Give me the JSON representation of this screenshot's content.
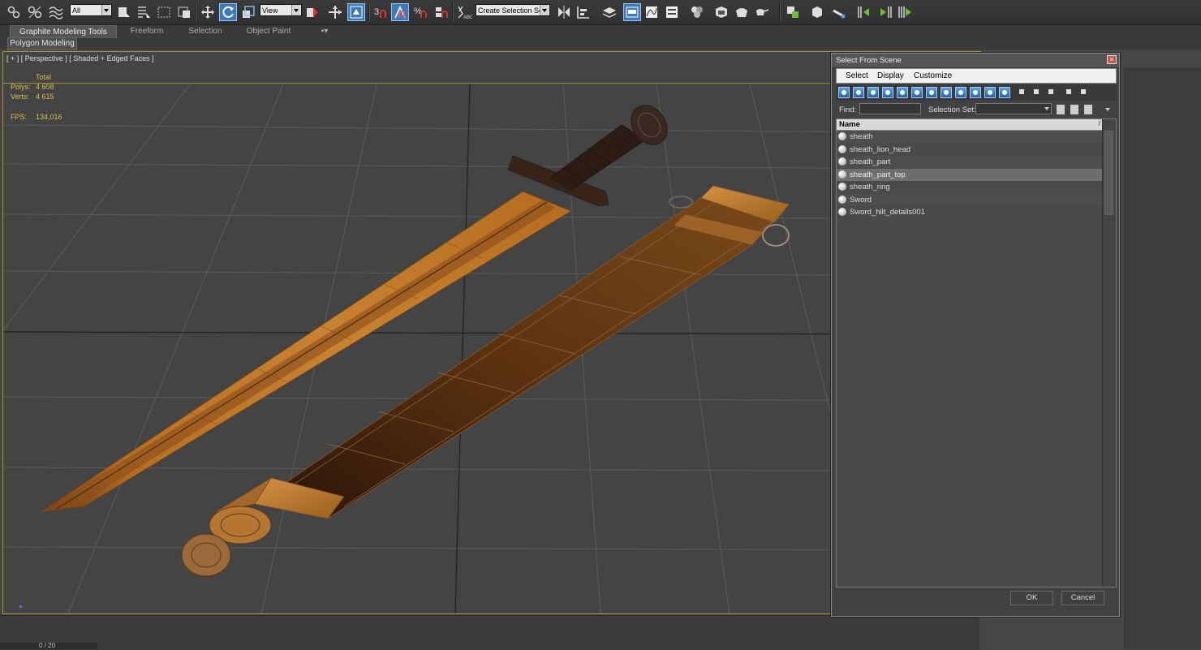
{
  "toolbar": {
    "selection_filter": "All",
    "reference_coordinate": "View",
    "named_selection_set": "Create Selection Se",
    "snaps_label": "3",
    "percent_snap_label": "%"
  },
  "ribbon": {
    "tabs": [
      "Graphite Modeling Tools",
      "Freeform",
      "Selection",
      "Object Paint"
    ],
    "panel": "Polygon Modeling"
  },
  "viewport": {
    "label": "[ + ] [ Perspective ] [ Shaded + Edged Faces ]",
    "stats": {
      "header": "Total",
      "polys_label": "Polys:",
      "polys_value": "4 608",
      "verts_label": "Verts:",
      "verts_value": "4 615",
      "fps_label": "FPS:",
      "fps_value": "134,016"
    }
  },
  "timeslider": {
    "label": "0 / 20"
  },
  "dialog": {
    "title": "Select From Scene",
    "close": "×",
    "menu": [
      "Select",
      "Display",
      "Customize"
    ],
    "find_label": "Find:",
    "find_value": "",
    "selection_set_label": "Selection Set:",
    "list_header": "Name",
    "sort_indicator": "/",
    "objects": [
      "sheath",
      "sheath_lion_head",
      "sheath_part",
      "sheath_part_top",
      "sheath_ring",
      "Sword",
      "Sword_hilt_details001"
    ],
    "selected_object": "sheath_part_top",
    "ok": "OK",
    "cancel": "Cancel"
  },
  "colors": {
    "viewport_border": "#a89436",
    "stats_text": "#d8c04a",
    "highlight_blue": "#3d7ab8",
    "sword_wood": "#b06d1e"
  }
}
